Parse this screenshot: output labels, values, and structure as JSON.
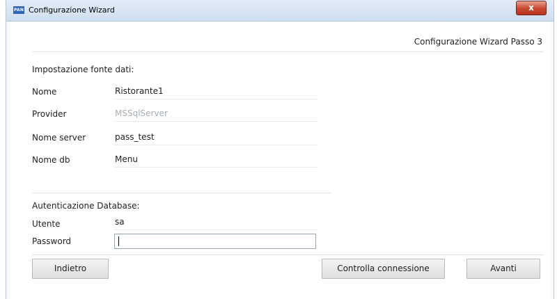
{
  "window": {
    "app_icon_text": "PAN",
    "title": "Configurazione Wizard",
    "close_label": "x"
  },
  "header": {
    "step_title": "Configurazione Wizard Passo 3"
  },
  "datasource": {
    "section_title": "Impostazione fonte dati:",
    "fields": [
      {
        "label": "Nome",
        "value": "Ristorante1"
      },
      {
        "label": "Provider",
        "value": "MSSqlServer"
      },
      {
        "label": "Nome server",
        "value": "pass_test"
      },
      {
        "label": "Nome db",
        "value": "Menu"
      }
    ]
  },
  "auth": {
    "section_title": "Autenticazione Database:",
    "user_label": "Utente",
    "user_value": "sa",
    "password_label": "Password",
    "password_value": ""
  },
  "buttons": {
    "back": "Indietro",
    "check_connection": "Controlla connessione",
    "next": "Avanti"
  }
}
